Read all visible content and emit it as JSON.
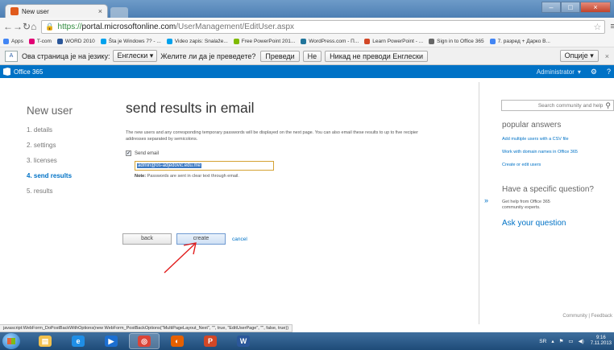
{
  "browser": {
    "tab_title": "New user",
    "tab_close": "×",
    "url_scheme": "https://",
    "url_host": "portal.microsoftonline.com",
    "url_path": "/UserManagement/EditUser.aspx",
    "window_controls": [
      "–",
      "□",
      "×"
    ]
  },
  "bookmarks": [
    {
      "label": "Apps",
      "color": "#4285f4"
    },
    {
      "label": "T-com",
      "color": "#e20074"
    },
    {
      "label": "WORD 2010",
      "color": "#2b579a"
    },
    {
      "label": "Šta je Windows 7? - ...",
      "color": "#00a2ed"
    },
    {
      "label": "Video zapis: Snalaže...",
      "color": "#00a2ed"
    },
    {
      "label": "Free PowerPoint 201...",
      "color": "#7fba00"
    },
    {
      "label": "WordPress.com - П...",
      "color": "#21759b"
    },
    {
      "label": "Learn PowerPoint - ...",
      "color": "#d24726"
    },
    {
      "label": "Sign in to Office 365",
      "color": "#666666"
    },
    {
      "label": "7. разред + Дарко В...",
      "color": "#4285f4"
    }
  ],
  "translate_bar": {
    "text": "Ова страница је на језику:",
    "language": "Енглески ▾",
    "question": "Желите ли да је преведете?",
    "translate_btn": "Преведи",
    "no_btn": "Не",
    "never_btn": "Никад не преводи Енглески",
    "options_btn": "Опције ▾",
    "close": "×"
  },
  "office_header": {
    "brand": "Office 365",
    "user": "Administrator",
    "user_chevron": "▾",
    "settings_glyph": "⚙",
    "help_glyph": "?"
  },
  "wizard": {
    "title": "New user",
    "steps": [
      {
        "label": "1.  details",
        "active": false
      },
      {
        "label": "2.  settings",
        "active": false
      },
      {
        "label": "3.  licenses",
        "active": false
      },
      {
        "label": "4.  send results",
        "active": true
      },
      {
        "label": "5.  results",
        "active": false
      }
    ]
  },
  "main": {
    "heading": "send results in email",
    "desc_line1": "The new users and any corresponding temporary passwords will be displayed on the next page. You can also email these results to up to five recipier",
    "desc_line2": "addresses separated by semicolons.",
    "send_email_label": "Send email",
    "send_email_checked": true,
    "email_value": "admin@os-adjedovic.edu.me",
    "note_label": "Note:",
    "note_text": "Passwords are sent in clear text through email."
  },
  "buttons": {
    "back": "back",
    "create": "create",
    "cancel": "cancel"
  },
  "right_pane": {
    "search_placeholder": "Search community and help",
    "popular_heading": "popular answers",
    "links": [
      "Add multiple users with a CSV file",
      "Work with domain names in Office 365",
      "Create or edit users"
    ],
    "question_heading": "Have a specific question?",
    "question_desc": "Get help from Office 365 community experts.",
    "ask_link": "Ask your question",
    "footer": "Community  |  Feedback"
  },
  "status_bar": {
    "text": "javascript:WebForm_DoPostBackWithOptions(new WebForm_PostBackOptions(\"MultiPageLayout_Next\", \"\", true, \"EditUserPage\", \"\", false, true))"
  },
  "taskbar": {
    "apps": [
      {
        "name": "explorer",
        "color": "#f2c14e",
        "glyph": "▤"
      },
      {
        "name": "ie",
        "color": "#1f8ee6",
        "glyph": "e"
      },
      {
        "name": "media",
        "color": "#1c6fd1",
        "glyph": "▶"
      },
      {
        "name": "chrome",
        "color": "#db4437",
        "glyph": "◎"
      },
      {
        "name": "firefox",
        "color": "#e66000",
        "glyph": "◐"
      },
      {
        "name": "powerpoint",
        "color": "#d24726",
        "glyph": "P"
      },
      {
        "name": "word",
        "color": "#2b579a",
        "glyph": "W"
      }
    ],
    "lang": "SR",
    "time": "9:16",
    "date": "7.11.2013"
  },
  "colors": {
    "accent": "#0072c6",
    "arrow": "#e11b1b"
  }
}
